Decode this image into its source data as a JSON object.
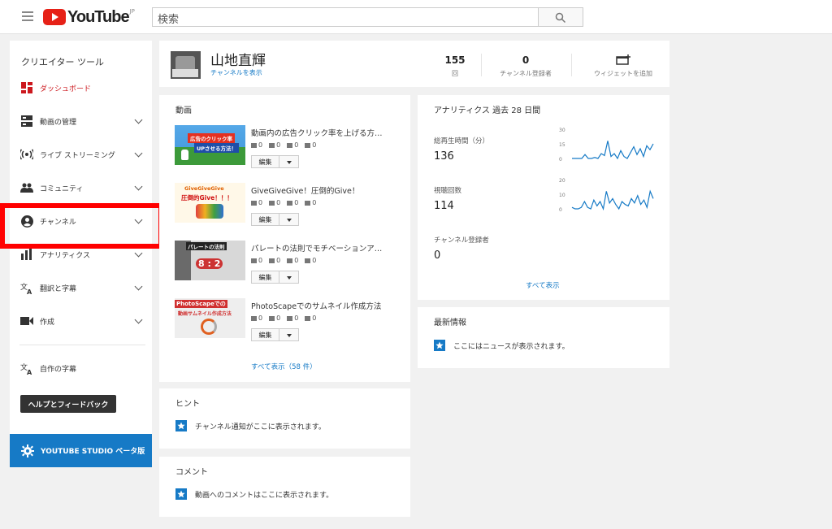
{
  "header": {
    "logo_text": "YouTube",
    "logo_region": "JP",
    "search_placeholder": "検索"
  },
  "sidebar": {
    "title": "クリエイター ツール",
    "items": [
      {
        "label": "ダッシュボード",
        "active": true
      },
      {
        "label": "動画の管理"
      },
      {
        "label": "ライブ ストリーミング"
      },
      {
        "label": "コミュニティ"
      },
      {
        "label": "チャンネル"
      },
      {
        "label": "アナリティクス"
      },
      {
        "label": "翻訳と字幕"
      },
      {
        "label": "作成"
      }
    ],
    "subtitles_label": "自作の字幕",
    "help_button": "ヘルプとフィードバック",
    "studio_button": "YOUTUBE STUDIO ベータ版"
  },
  "channel": {
    "name": "山地直輝",
    "view_link": "チャンネルを表示",
    "stats": [
      {
        "value": "155",
        "label": "回"
      },
      {
        "value": "0",
        "label": "チャンネル登録者"
      }
    ],
    "widget_label": "ウィジェットを追加"
  },
  "videos": {
    "title": "動画",
    "items": [
      {
        "title": "動画内の広告クリック率を上げる方…",
        "thumb_text_1": "広告のクリック率",
        "thumb_text_2": "UPさせる方法！",
        "views": "0",
        "comments": "0",
        "likes": "0",
        "dislikes": "0"
      },
      {
        "title": "GiveGiveGive！圧倒的Give！",
        "thumb_text_1": "GiveGiveGive",
        "thumb_text_2": "圧倒的Give！！！",
        "views": "0",
        "comments": "0",
        "likes": "0",
        "dislikes": "0"
      },
      {
        "title": "パレートの法則でモチベーションア…",
        "thumb_text_1": "パレートの法則",
        "thumb_text_2": "8 : 2",
        "views": "0",
        "comments": "0",
        "likes": "0",
        "dislikes": "0"
      },
      {
        "title": "PhotoScapeでのサムネイル作成方法",
        "thumb_text_1": "PhotoScapeでの",
        "thumb_text_2": "動画サムネイル作成方法",
        "views": "0",
        "comments": "0",
        "likes": "0",
        "dislikes": "0"
      }
    ],
    "edit_label": "編集",
    "see_all": "すべて表示（58 件）"
  },
  "analytics": {
    "title": "アナリティクス  過去 28 日間",
    "metrics": [
      {
        "label": "総再生時間（分）",
        "value": "136",
        "ticks": [
          "30",
          "15",
          "0"
        ],
        "points": [
          0,
          0,
          0,
          0,
          4,
          0,
          0,
          1,
          0,
          5,
          3,
          18,
          2,
          5,
          0,
          8,
          2,
          0,
          6,
          12,
          4,
          10,
          2,
          13,
          9,
          15
        ]
      },
      {
        "label": "視聴回数",
        "value": "114",
        "ticks": [
          "20",
          "10",
          "0"
        ],
        "points": [
          1,
          0,
          0,
          1,
          5,
          1,
          0,
          6,
          2,
          5,
          0,
          12,
          4,
          7,
          3,
          0,
          5,
          3,
          2,
          7,
          4,
          9,
          3,
          6,
          1,
          12,
          7
        ]
      },
      {
        "label": "チャンネル登録者",
        "value": "0"
      }
    ],
    "see_all": "すべて表示"
  },
  "hint": {
    "title": "ヒント",
    "text": "チャンネル通知がここに表示されます。"
  },
  "comments": {
    "title": "コメント",
    "text": "動画へのコメントはここに表示されます。"
  },
  "latest": {
    "title": "最新情報",
    "text": "ここにはニュースが表示されます。"
  },
  "colors": {
    "brand_red": "#e62117",
    "link_blue": "#167ac6",
    "highlight": "#ff0000"
  }
}
